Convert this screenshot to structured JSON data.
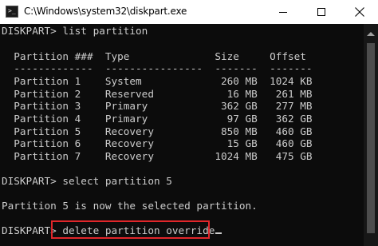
{
  "window": {
    "title": "C:\\Windows\\system32\\diskpart.exe",
    "icon": "cmd-icon",
    "icon_glyph": ">_",
    "controls": [
      "minimize-icon",
      "maximize-icon",
      "close-icon"
    ]
  },
  "console": {
    "lines": [
      "DISKPART> list partition",
      "",
      "  Partition ###  Type              Size     Offset",
      "  -------------  ----------------  -------  -------",
      "  Partition 1    System             260 MB  1024 KB",
      "  Partition 2    Reserved            16 MB   261 MB",
      "  Partition 3    Primary            362 GB   277 MB",
      "  Partition 4    Primary             97 GB   362 GB",
      "  Partition 5    Recovery           850 MB   460 GB",
      "  Partition 6    Recovery            15 GB   460 GB",
      "  Partition 7    Recovery          1024 MB   475 GB",
      "",
      "DISKPART> select partition 5",
      "",
      "Partition 5 is now the selected partition.",
      ""
    ],
    "current_command": "DISKPART> delete partition override"
  },
  "colors": {
    "console_background": "#0c0c0c",
    "console_text": "#cccccc",
    "titlebar_background": "#ffffff",
    "highlight_border": "#e0262a"
  }
}
